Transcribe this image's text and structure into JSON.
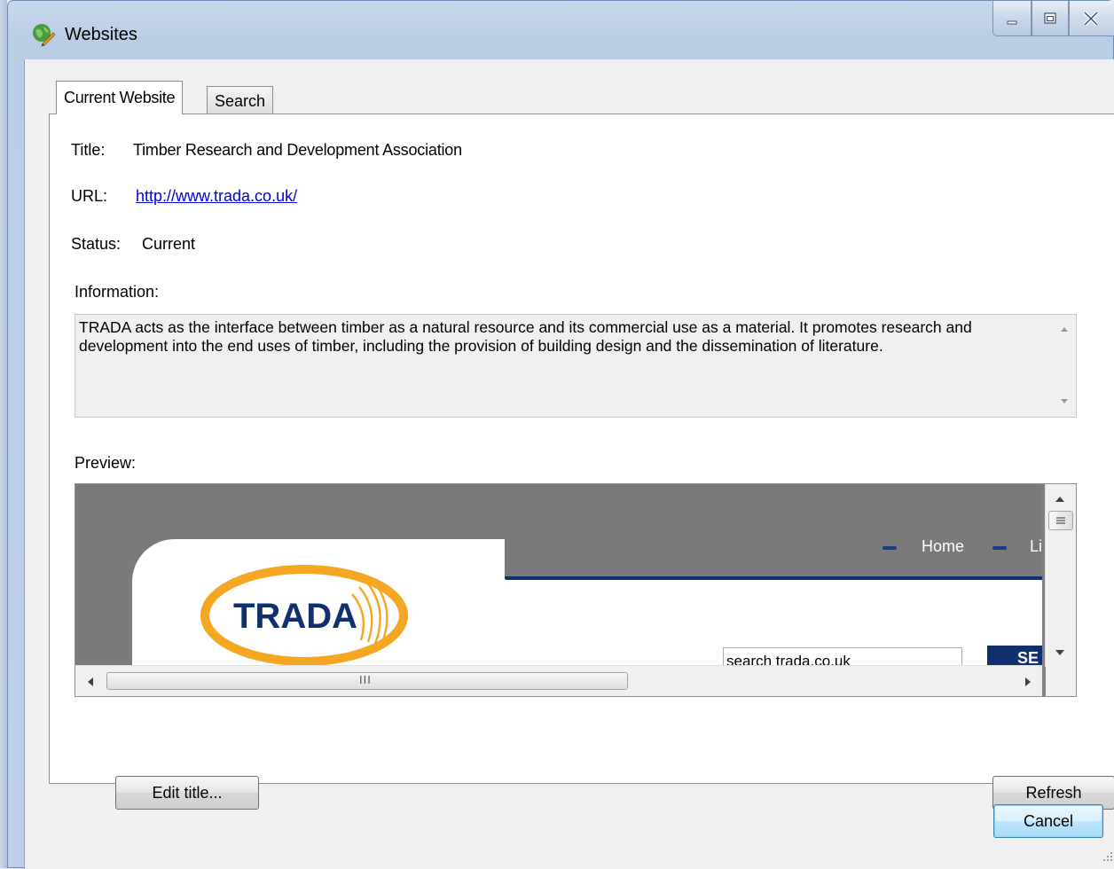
{
  "window": {
    "title": "Websites"
  },
  "tabs": [
    {
      "label": "Current Website",
      "active": true
    },
    {
      "label": "Search",
      "active": false
    }
  ],
  "fields": {
    "title_label": "Title:",
    "title_value": "Timber Research and Development Association",
    "url_label": "URL:",
    "url_value": "http://www.trada.co.uk/",
    "status_label": "Status:",
    "status_value": "Current",
    "information_label": "Information:",
    "information_text": "TRADA acts as the interface between timber as a natural resource and its commercial use as a material.  It promotes research and development into the end uses of timber, including the provision of building design and the dissemination of literature.",
    "preview_label": "Preview:"
  },
  "preview": {
    "logo_text": "TRADA",
    "nav_home": "Home",
    "nav_next": "Li",
    "search_value": "search trada.co.uk",
    "search_button_partial": "SE",
    "hscroll_grip": "III"
  },
  "buttons": {
    "edit_title": "Edit title...",
    "refresh": "Refresh",
    "cancel": "Cancel"
  },
  "colors": {
    "link": "#0000e6",
    "trada_orange": "#f5a623",
    "trada_blue": "#10306f"
  }
}
